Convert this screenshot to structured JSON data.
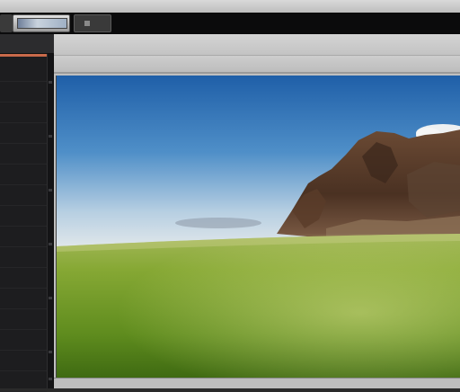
{
  "app": {
    "title": ""
  },
  "tabs": [
    {
      "icon": "panel-tab-icon"
    },
    {
      "icon": "image-thumbnail-icon"
    },
    {
      "icon": "document-tab-icon"
    }
  ],
  "colors": {
    "accent": "#c86a4a",
    "panel_bg": "#1d1d1f",
    "toolbar_bg": "#c9c9c9"
  },
  "viewport": {
    "content": "landscape-image"
  }
}
